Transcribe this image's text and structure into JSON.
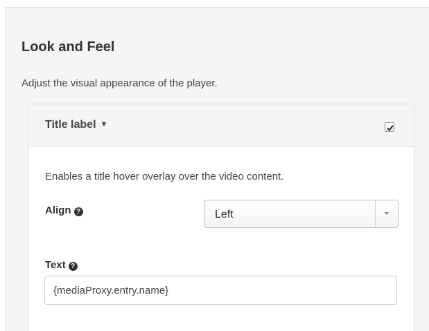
{
  "section": {
    "title": "Look and Feel",
    "description": "Adjust the visual appearance of the player."
  },
  "plugin": {
    "title": "Title label",
    "caret": "▼",
    "enabled": true,
    "description": "Enables a title hover overlay over the video content.",
    "align": {
      "label": "Align",
      "help_icon": "question-circle-icon",
      "help_glyph": "?",
      "value": "Left",
      "options": [
        "Left"
      ]
    },
    "text": {
      "label": "Text",
      "help_icon": "question-circle-icon",
      "help_glyph": "?",
      "value": "{mediaProxy.entry.name}"
    }
  },
  "colors": {
    "panel_bg": "#f5f5f5",
    "card_bg": "#ffffff",
    "border": "#dddddd",
    "text": "#333333"
  }
}
